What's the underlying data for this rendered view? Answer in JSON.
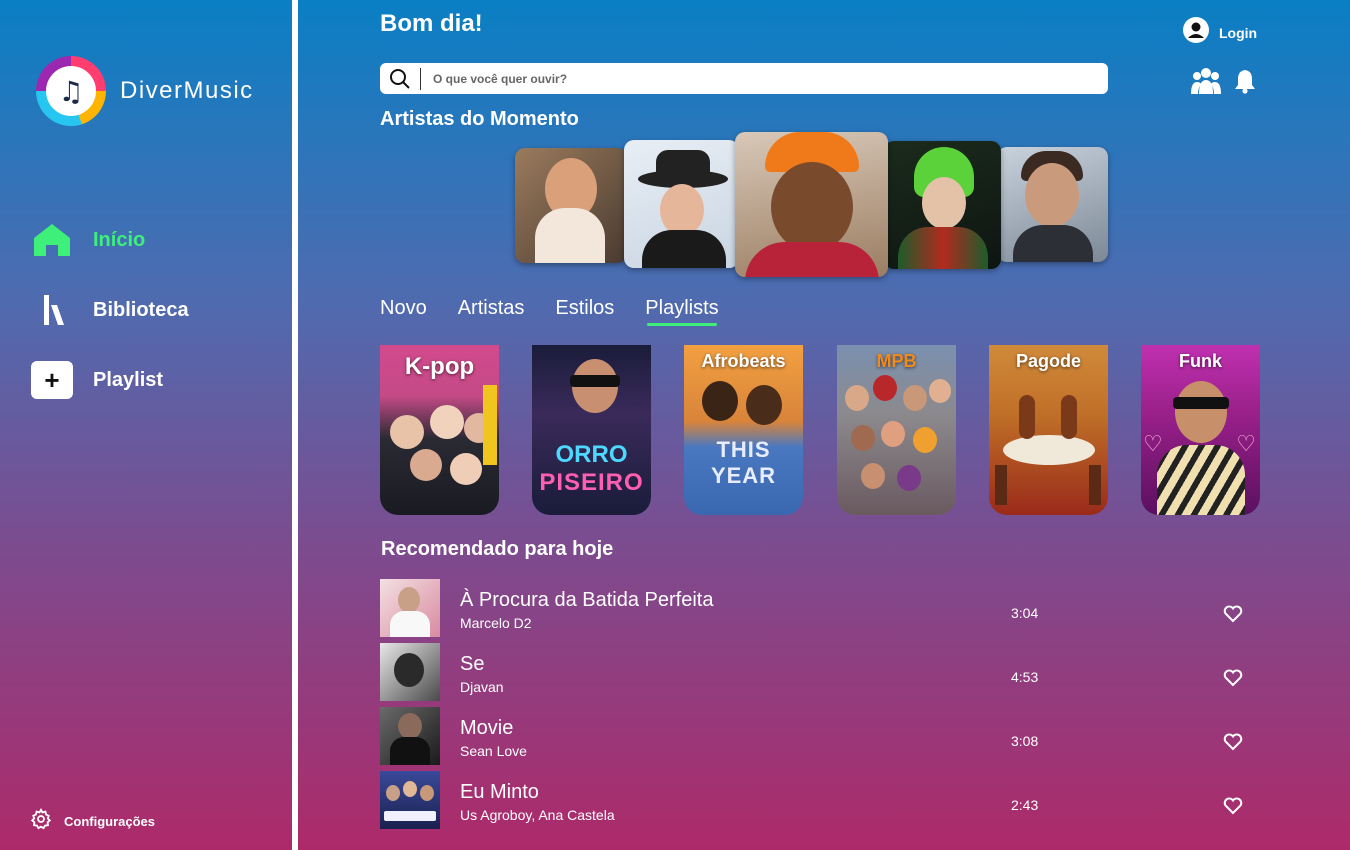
{
  "app": {
    "name": "DiverMusic"
  },
  "sidebar": {
    "items": [
      {
        "label": "Início",
        "icon": "home-icon",
        "active": true
      },
      {
        "label": "Biblioteca",
        "icon": "library-icon",
        "active": false
      },
      {
        "label": "Playlist",
        "icon": "plus-icon",
        "active": false
      }
    ],
    "settings_label": "Configurações"
  },
  "header": {
    "greeting": "Bom dia!",
    "login_label": "Login",
    "search_placeholder": "O que você quer ouvir?"
  },
  "artists": {
    "title": "Artistas do Momento"
  },
  "tabs": [
    {
      "label": "Novo",
      "active": false
    },
    {
      "label": "Artistas",
      "active": false
    },
    {
      "label": "Estilos",
      "active": false
    },
    {
      "label": "Playlists",
      "active": true
    }
  ],
  "genres": [
    {
      "label": "K-pop",
      "overlay": ""
    },
    {
      "label": "",
      "overlay": "PISEIRO"
    },
    {
      "label": "Afrobeats",
      "overlay": "THIS YEAR"
    },
    {
      "label": "MPB",
      "overlay": ""
    },
    {
      "label": "Pagode",
      "overlay": ""
    },
    {
      "label": "Funk",
      "overlay": ""
    }
  ],
  "recommended": {
    "title": "Recomendado para hoje",
    "tracks": [
      {
        "title": "À Procura da Batida Perfeita",
        "artist": "Marcelo D2",
        "duration": "3:04"
      },
      {
        "title": "Se",
        "artist": "Djavan",
        "duration": "4:53"
      },
      {
        "title": "Movie",
        "artist": "Sean Love",
        "duration": "3:08"
      },
      {
        "title": "Eu Minto",
        "artist": "Us Agroboy, Ana Castela",
        "duration": "2:43"
      }
    ]
  },
  "colors": {
    "accent": "#3ef07a",
    "text": "#ffffff"
  }
}
